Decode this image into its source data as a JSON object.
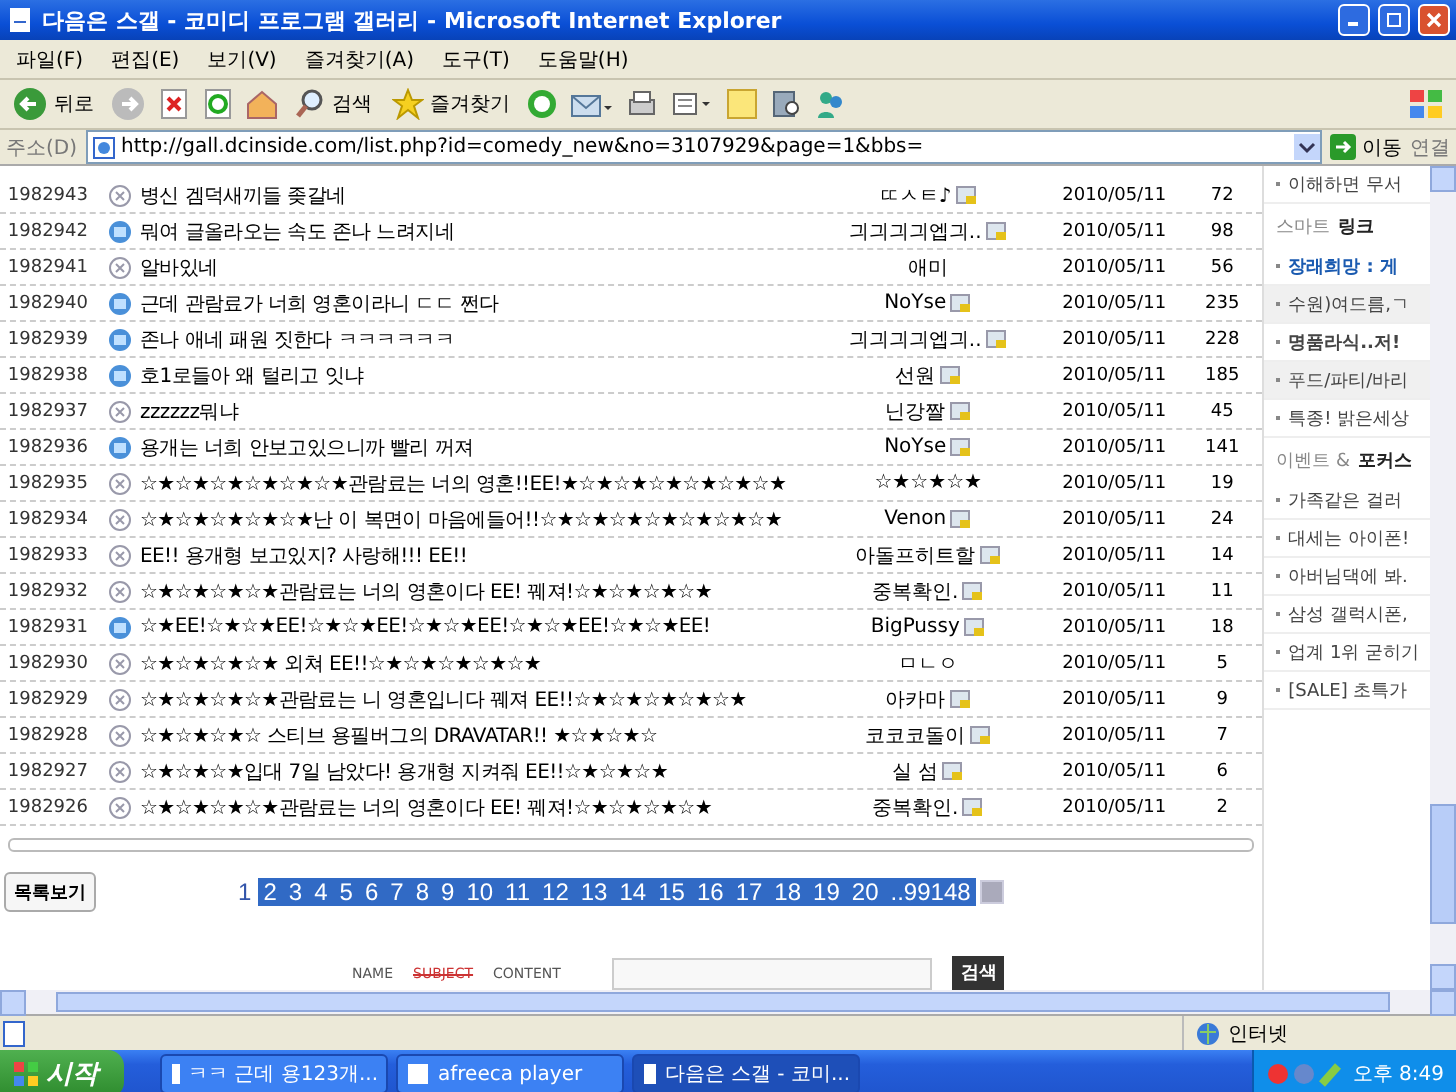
{
  "window": {
    "title": "다음은 스갤 - 코미디 프로그램 갤러리 - Microsoft Internet Explorer"
  },
  "menu": [
    "파일(F)",
    "편집(E)",
    "보기(V)",
    "즐겨찾기(A)",
    "도구(T)",
    "도움말(H)"
  ],
  "toolbar": {
    "back": "뒤로",
    "search": "검색",
    "favorites": "즐겨찾기"
  },
  "address": {
    "label": "주소(D)",
    "url": "http://gall.dcinside.com/list.php?id=comedy_new&no=3107929&page=1&bbs=",
    "go": "이동",
    "links": "연결"
  },
  "posts": [
    {
      "number": "1982943",
      "kind": "text",
      "title": "병신 겜덕새끼들 좆갈네",
      "author": "ㄸㅅㅌ♪",
      "member_icon": true,
      "date": "2010/05/11",
      "views": "72"
    },
    {
      "number": "1982942",
      "kind": "photo",
      "title": "뭐여 글올라오는 속도 존나 느려지네",
      "author": "긔긔긔긔엡긔..",
      "member_icon": true,
      "date": "2010/05/11",
      "views": "98"
    },
    {
      "number": "1982941",
      "kind": "text",
      "title": "알바있네",
      "author": "애미",
      "member_icon": false,
      "date": "2010/05/11",
      "views": "56"
    },
    {
      "number": "1982940",
      "kind": "photo",
      "title": "근데 관람료가 너희 영혼이라니 ㄷㄷ 쩐다",
      "author": "NoYse",
      "member_icon": true,
      "date": "2010/05/11",
      "views": "235"
    },
    {
      "number": "1982939",
      "kind": "photo",
      "title": "존나 애네 패원 짓한다 ㅋㅋㅋㅋㅋㅋ",
      "author": "긔긔긔긔엡긔..",
      "member_icon": true,
      "date": "2010/05/11",
      "views": "228"
    },
    {
      "number": "1982938",
      "kind": "photo",
      "title": "호1로들아 왜 털리고 잇냐",
      "author": "선원",
      "member_icon": true,
      "date": "2010/05/11",
      "views": "185"
    },
    {
      "number": "1982937",
      "kind": "text",
      "title": "zzzzzz뭐냐",
      "author": "닌강짤",
      "member_icon": true,
      "date": "2010/05/11",
      "views": "45"
    },
    {
      "number": "1982936",
      "kind": "photo",
      "title": "용개는 너희 안보고있으니까 빨리 꺼져",
      "author": "NoYse",
      "member_icon": true,
      "date": "2010/05/11",
      "views": "141"
    },
    {
      "number": "1982935",
      "kind": "text",
      "title": "☆★☆★☆★☆★☆★☆★관람료는 너의 영혼!!EE!★☆★☆★☆★☆★☆★☆★",
      "author": "☆★☆★☆★",
      "member_icon": false,
      "date": "2010/05/11",
      "views": "19"
    },
    {
      "number": "1982934",
      "kind": "text",
      "title": "☆★☆★☆★☆★☆★난 이 복면이 마음에들어!!☆★☆★☆★☆★☆★☆★☆★",
      "author": "Venon",
      "member_icon": true,
      "date": "2010/05/11",
      "views": "24"
    },
    {
      "number": "1982933",
      "kind": "text",
      "title": "EE!! 용개형 보고있지? 사랑해!!! EE!!",
      "author": "아돌프히트할",
      "member_icon": true,
      "date": "2010/05/11",
      "views": "14"
    },
    {
      "number": "1982932",
      "kind": "text",
      "title": "☆★☆★☆★☆★관람료는 너의 영혼이다 EE! 꿰져!☆★☆★☆★☆★",
      "author": "중복확인.",
      "member_icon": true,
      "date": "2010/05/11",
      "views": "11"
    },
    {
      "number": "1982931",
      "kind": "photo",
      "title": "☆★EE!☆★☆★EE!☆★☆★EE!☆★☆★EE!☆★☆★EE!☆★☆★EE!",
      "author": "BigPussy",
      "member_icon": true,
      "date": "2010/05/11",
      "views": "18"
    },
    {
      "number": "1982930",
      "kind": "text",
      "title": "☆★☆★☆★☆★ 외쳐 EE!!☆★☆★☆★☆★☆★",
      "author": "ㅁㄴㅇ",
      "member_icon": false,
      "date": "2010/05/11",
      "views": "5"
    },
    {
      "number": "1982929",
      "kind": "text",
      "title": "☆★☆★☆★☆★관람료는 니 영혼입니다 꿰져 EE!!☆★☆★☆★☆★☆★",
      "author": "아카마",
      "member_icon": true,
      "date": "2010/05/11",
      "views": "9"
    },
    {
      "number": "1982928",
      "kind": "text",
      "title": "☆★☆★☆★☆ 스티브 용필버그의 DRAVATAR!! ★☆★☆★☆",
      "author": "코코코돌이",
      "member_icon": true,
      "date": "2010/05/11",
      "views": "7"
    },
    {
      "number": "1982927",
      "kind": "text",
      "title": "☆★☆★☆★입대 7일 남았다! 용개형 지켜줘 EE!!☆★☆★☆★",
      "author": "실 섬",
      "member_icon": true,
      "date": "2010/05/11",
      "views": "6"
    },
    {
      "number": "1982926",
      "kind": "text",
      "title": "☆★☆★☆★☆★관람료는 너의 영혼이다 EE! 꿰져!☆★☆★☆★☆★",
      "author": "중복확인.",
      "member_icon": true,
      "date": "2010/05/11",
      "views": "2"
    }
  ],
  "sidebar": {
    "top_item": "이해하면 무서",
    "sections": [
      {
        "title": "스마트 **링크**",
        "items": [
          {
            "text": "장래희망 : 게",
            "kind": "featured",
            "shaded": false
          },
          {
            "text": "수원)여드름,ㄱ",
            "kind": "plain",
            "shaded": true
          },
          {
            "text": "명품라식..저!",
            "kind": "bold",
            "shaded": false
          },
          {
            "text": "푸드/파티/바리",
            "kind": "plain",
            "shaded": true
          },
          {
            "text": "특종! 밝은세상",
            "kind": "plain",
            "shaded": false
          }
        ]
      },
      {
        "title": "이벤트 & **포커스**",
        "items": [
          {
            "text": "가족같은 걸러",
            "kind": "plain",
            "shaded": false
          },
          {
            "text": "대세는 아이폰!",
            "kind": "plain",
            "shaded": false
          },
          {
            "text": "아버님댁에 봐.",
            "kind": "plain",
            "shaded": false
          },
          {
            "text": "삼성 갤럭시폰,",
            "kind": "plain",
            "shaded": false
          },
          {
            "text": "업계 1위 굳히기",
            "kind": "plain",
            "shaded": false
          },
          {
            "text": "[SALE] 초특가",
            "kind": "plain",
            "shaded": false
          }
        ]
      }
    ]
  },
  "list_button": "목록보기",
  "pagination": [
    {
      "label": "1",
      "highlighted": false
    },
    {
      "label": "2",
      "highlighted": true
    },
    {
      "label": "3",
      "highlighted": true
    },
    {
      "label": "4",
      "highlighted": true
    },
    {
      "label": "5",
      "highlighted": true
    },
    {
      "label": "6",
      "highlighted": true
    },
    {
      "label": "7",
      "highlighted": true
    },
    {
      "label": "8",
      "highlighted": true
    },
    {
      "label": "9",
      "highlighted": true
    },
    {
      "label": "10",
      "highlighted": true
    },
    {
      "label": "11",
      "highlighted": true
    },
    {
      "label": "12",
      "highlighted": true
    },
    {
      "label": "13",
      "highlighted": true
    },
    {
      "label": "14",
      "highlighted": true
    },
    {
      "label": "15",
      "highlighted": true
    },
    {
      "label": "16",
      "highlighted": true
    },
    {
      "label": "17",
      "highlighted": true
    },
    {
      "label": "18",
      "highlighted": true
    },
    {
      "label": "19",
      "highlighted": true
    },
    {
      "label": "20",
      "highlighted": true
    },
    {
      "label": "..99148",
      "highlighted": true
    }
  ],
  "search": {
    "options": [
      {
        "label": "NAME",
        "selected": false
      },
      {
        "label": "SUBJECT",
        "selected": true
      },
      {
        "label": "CONTENT",
        "selected": false
      }
    ],
    "button": "검색"
  },
  "status_bar": {
    "zone": "인터넷"
  },
  "taskbar": {
    "start": "시작",
    "tasks": [
      {
        "label": "ㅋㅋ 근데 용123개...",
        "selected": false
      },
      {
        "label": "afreeca player",
        "selected": false
      },
      {
        "label": "다음은 스갤 - 코미...",
        "selected": true
      }
    ],
    "clock": "오후 8:49"
  }
}
